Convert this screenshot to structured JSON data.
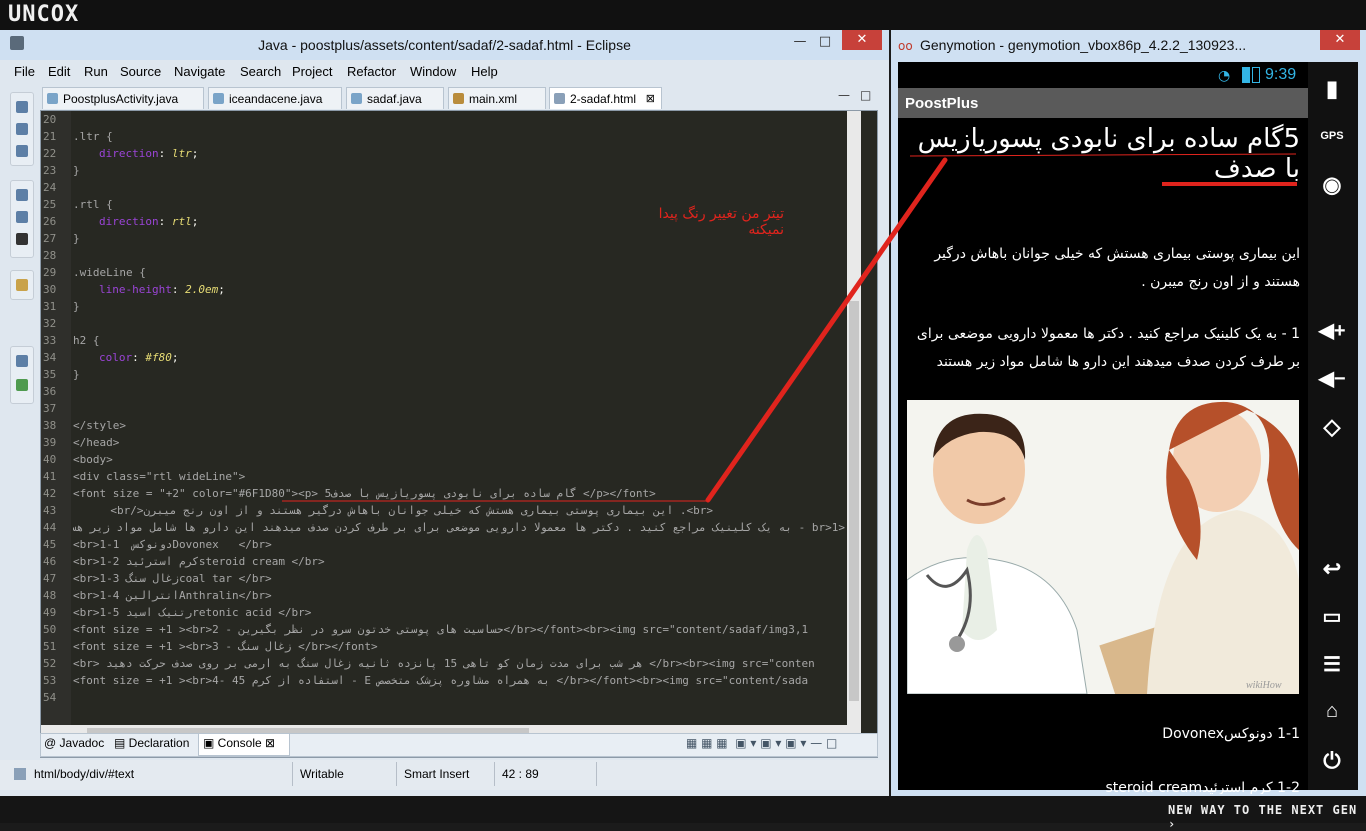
{
  "brand": "UNCOX",
  "slogan": "NEW WAY TO THE NEXT GEN ›",
  "eclipse": {
    "title": "Java - poostplus/assets/content/sadaf/2-sadaf.html - Eclipse",
    "menus": [
      "File",
      "Edit",
      "Run",
      "Source",
      "Navigate",
      "Search",
      "Project",
      "Refactor",
      "Window",
      "Help"
    ],
    "tabs": [
      "PoostplusActivity.java",
      "iceandacene.java",
      "sadaf.java",
      "main.xml",
      "2-sadaf.html"
    ],
    "line_numbers": [
      "20",
      "21",
      "22",
      "23",
      "24",
      "25",
      "26",
      "27",
      "28",
      "29",
      "30",
      "31",
      "32",
      "33",
      "34",
      "35",
      "36",
      "37",
      "38",
      "39",
      "40",
      "41",
      "42",
      "43",
      "44",
      "45",
      "46",
      "47",
      "48",
      "49",
      "50",
      "51",
      "52",
      "53",
      "54"
    ],
    "code": {
      "l20": ".ltr {",
      "l21p": "direction",
      "l21v": "ltr",
      "l22": "}",
      "l24": ".rtl {",
      "l25p": "direction",
      "l25v": "rtl",
      "l26": "}",
      "l28": ".wideLine {",
      "l29p": "line-height",
      "l29v": "2.0em",
      "l30": "}",
      "l32": "h2 {",
      "l33p": "color",
      "l33v": "#f80",
      "l34": "}",
      "l37": "</style>",
      "l38": "</head>",
      "l39": "<body>",
      "l40": "<div class=\"rtl wideLine\">",
      "l41": "<font size = \"+2\" color=\"#6F1D80\"><p> 5گام ساده برای نابودی پسوریازیس با صدف </p></font>",
      "l42": "<br>. این بیماری پوستی بیماری هستش که خیلی جوانان باهاش درگیر هستند و از اون رنج میبرن</br>",
      "l43": "<br>1 - به یک کلینیک مراجع کنید . دکتر ها معمولا دارویی موضعی برای بر طرف کردن صدف میدهند این دارو ها شامل مواد زیر هستند",
      "l44": "<br>1-1  دونوکسDovonex   </br>",
      "l45": "<br>1-2 کرم استرئیدsteroid cream </br>",
      "l46": "<br>1-3 زغال سنگcoal tar </br>",
      "l47": "<br>1-4 انترالینAnthralin</br>",
      "l48": "<br>1-5 رتنیک اسیدretonic acid </br>",
      "l49": "<font size = +1 ><br>2 - حساسیت های پوستی خدتون سرو در نظر بگیرین</br></font><br><img src=\"content/sadaf/img3,1",
      "l50": "<font size = +1 ><br>3 - زغال سنگ </br></font>",
      "l51": "<br> هر شب برای مدت زمان کو تاهی 15 پانزده ثانیه زغال سنگ به ارمی بر روی صدف حرکت دهید </br><br><img src=\"conten",
      "l52": "<font size = +1 ><br>4- استفاده از کرم 45 - E به همراه مشاوره پزشک متخصص </br></font><br><img src=\"content/sada"
    },
    "annotation": "تیتر من تغییر رنگ پیدا نمیکنه",
    "bottom_tabs": [
      "Javadoc",
      "Declaration",
      "Console"
    ],
    "status": {
      "path": "html/body/div/#text",
      "mode": "Writable",
      "insert": "Smart Insert",
      "pos": "42 : 89"
    }
  },
  "geny": {
    "title": "Genymotion - genymotion_vbox86p_4.2.2_130923...",
    "clock": "9:39",
    "app_title": "PoostPlus",
    "heading": "5گام ساده برای نابودی پسوریازیس با صدف",
    "para1": "این بیماری پوستی بیماری هستش که خیلی جوانان باهاش درگیر هستند و از اون رنج میبرن .",
    "para2": "1 - به یک کلینیک مراجع کنید . دکتر ها معمولا دارویی موضعی برای بر طرف کردن صدف میدهند این دارو ها شامل مواد زیر هستند",
    "item1": "1-1 دونوکسDovonex",
    "item2": "1-2 کرم استرئیدsteroid cream",
    "wikihow": "wikiHow",
    "gps": "GPS"
  },
  "colors": {
    "editor_bg": "#272822",
    "annotation": "#e0241d",
    "clock": "#33b5e5"
  }
}
